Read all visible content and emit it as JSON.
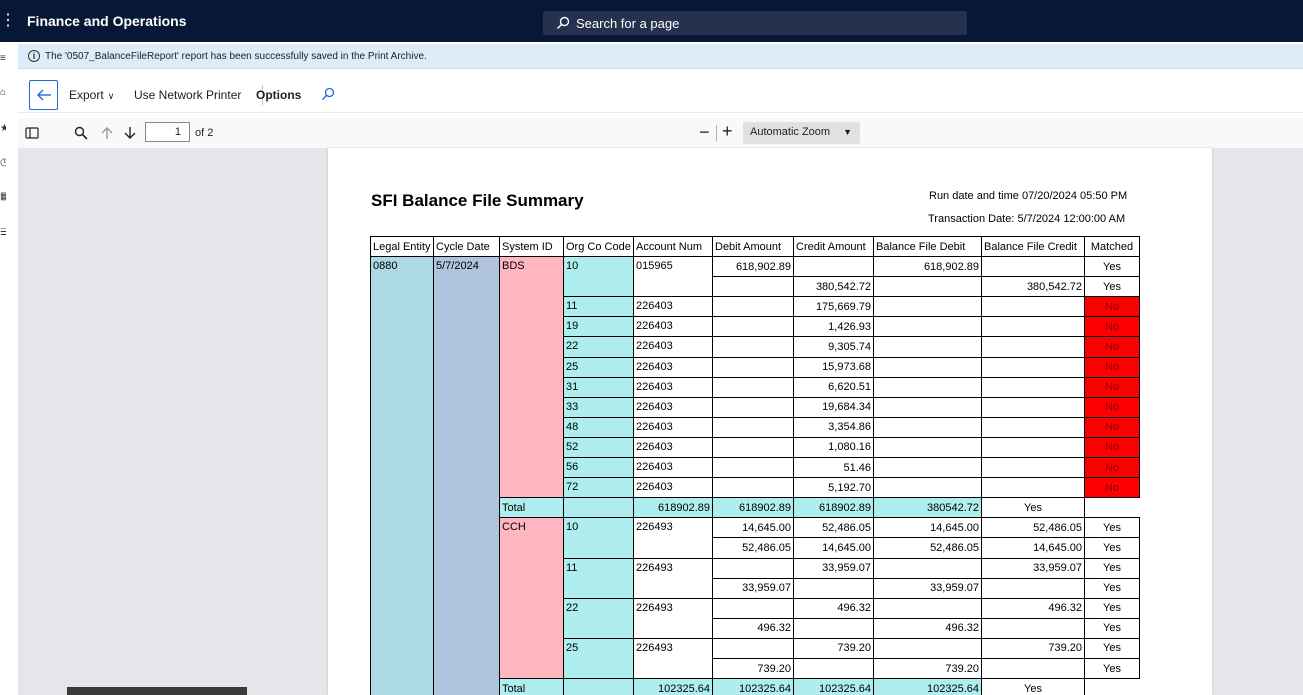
{
  "app": {
    "title": "Finance and Operations",
    "search_placeholder": "Search for a page"
  },
  "message": {
    "text": "The '0507_BalanceFileReport' report has been successfully saved in the Print Archive."
  },
  "actions": {
    "export_label": "Export",
    "network_printer_label": "Use Network Printer",
    "options_label": "Options"
  },
  "pdf_toolbar": {
    "current_page": "1",
    "page_of": "of 2",
    "zoom": "Automatic Zoom"
  },
  "report": {
    "title": "SFI Balance File Summary",
    "run_info": "Run date and time 07/20/2024 05:50 PM",
    "txn_info": "Transaction Date: 5/7/2024 12:00:00 AM",
    "headers": [
      "Legal Entity",
      "Cycle Date",
      "System ID",
      "Org Co Code",
      "Account Num",
      "Debit Amount",
      "Credit Amount",
      "Balance File Debit",
      "Balance File Credit",
      "Matched"
    ],
    "legal_entity": "0880",
    "cycle_date": "5/7/2024",
    "groups": [
      {
        "system_id": "BDS",
        "rows": [
          {
            "org": "10",
            "acct": "015965",
            "debit": "618,902.89",
            "credit": "",
            "bf_debit": "618,902.89",
            "bf_credit": "",
            "matched": "Yes"
          },
          {
            "org": "",
            "acct": "",
            "debit": "",
            "credit": "380,542.72",
            "bf_debit": "",
            "bf_credit": "380,542.72",
            "matched": "Yes"
          },
          {
            "org": "11",
            "acct": "226403",
            "debit": "",
            "credit": "175,669.79",
            "bf_debit": "",
            "bf_credit": "",
            "matched": "No"
          },
          {
            "org": "19",
            "acct": "226403",
            "debit": "",
            "credit": "1,426.93",
            "bf_debit": "",
            "bf_credit": "",
            "matched": "No"
          },
          {
            "org": "22",
            "acct": "226403",
            "debit": "",
            "credit": "9,305.74",
            "bf_debit": "",
            "bf_credit": "",
            "matched": "No"
          },
          {
            "org": "25",
            "acct": "226403",
            "debit": "",
            "credit": "15,973.68",
            "bf_debit": "",
            "bf_credit": "",
            "matched": "No"
          },
          {
            "org": "31",
            "acct": "226403",
            "debit": "",
            "credit": "6,620.51",
            "bf_debit": "",
            "bf_credit": "",
            "matched": "No"
          },
          {
            "org": "33",
            "acct": "226403",
            "debit": "",
            "credit": "19,684.34",
            "bf_debit": "",
            "bf_credit": "",
            "matched": "No"
          },
          {
            "org": "48",
            "acct": "226403",
            "debit": "",
            "credit": "3,354.86",
            "bf_debit": "",
            "bf_credit": "",
            "matched": "No"
          },
          {
            "org": "52",
            "acct": "226403",
            "debit": "",
            "credit": "1,080.16",
            "bf_debit": "",
            "bf_credit": "",
            "matched": "No"
          },
          {
            "org": "56",
            "acct": "226403",
            "debit": "",
            "credit": "51.46",
            "bf_debit": "",
            "bf_credit": "",
            "matched": "No"
          },
          {
            "org": "72",
            "acct": "226403",
            "debit": "",
            "credit": "5,192.70",
            "bf_debit": "",
            "bf_credit": "",
            "matched": "No"
          }
        ],
        "total": {
          "label": "Total",
          "debit": "618902.89",
          "credit": "618902.89",
          "bf_debit": "618902.89",
          "bf_credit": "380542.72",
          "matched": "Yes"
        }
      },
      {
        "system_id": "CCH",
        "rows": [
          {
            "org": "10",
            "acct": "226493",
            "debit": "14,645.00",
            "credit": "52,486.05",
            "bf_debit": "14,645.00",
            "bf_credit": "52,486.05",
            "matched": "Yes"
          },
          {
            "org": "",
            "acct": "",
            "debit": "52,486.05",
            "credit": "14,645.00",
            "bf_debit": "52,486.05",
            "bf_credit": "14,645.00",
            "matched": "Yes"
          },
          {
            "org": "11",
            "acct": "226493",
            "debit": "",
            "credit": "33,959.07",
            "bf_debit": "",
            "bf_credit": "33,959.07",
            "matched": "Yes"
          },
          {
            "org": "",
            "acct": "",
            "debit": "33,959.07",
            "credit": "",
            "bf_debit": "33,959.07",
            "bf_credit": "",
            "matched": "Yes"
          },
          {
            "org": "22",
            "acct": "226493",
            "debit": "",
            "credit": "496.32",
            "bf_debit": "",
            "bf_credit": "496.32",
            "matched": "Yes"
          },
          {
            "org": "",
            "acct": "",
            "debit": "496.32",
            "credit": "",
            "bf_debit": "496.32",
            "bf_credit": "",
            "matched": "Yes"
          },
          {
            "org": "25",
            "acct": "226493",
            "debit": "",
            "credit": "739.20",
            "bf_debit": "",
            "bf_credit": "739.20",
            "matched": "Yes"
          },
          {
            "org": "",
            "acct": "",
            "debit": "739.20",
            "credit": "",
            "bf_debit": "739.20",
            "bf_credit": "",
            "matched": "Yes"
          }
        ],
        "total": {
          "label": "Total",
          "debit": "102325.64",
          "credit": "102325.64",
          "bf_debit": "102325.64",
          "bf_credit": "102325.64",
          "matched": "Yes"
        }
      }
    ]
  }
}
